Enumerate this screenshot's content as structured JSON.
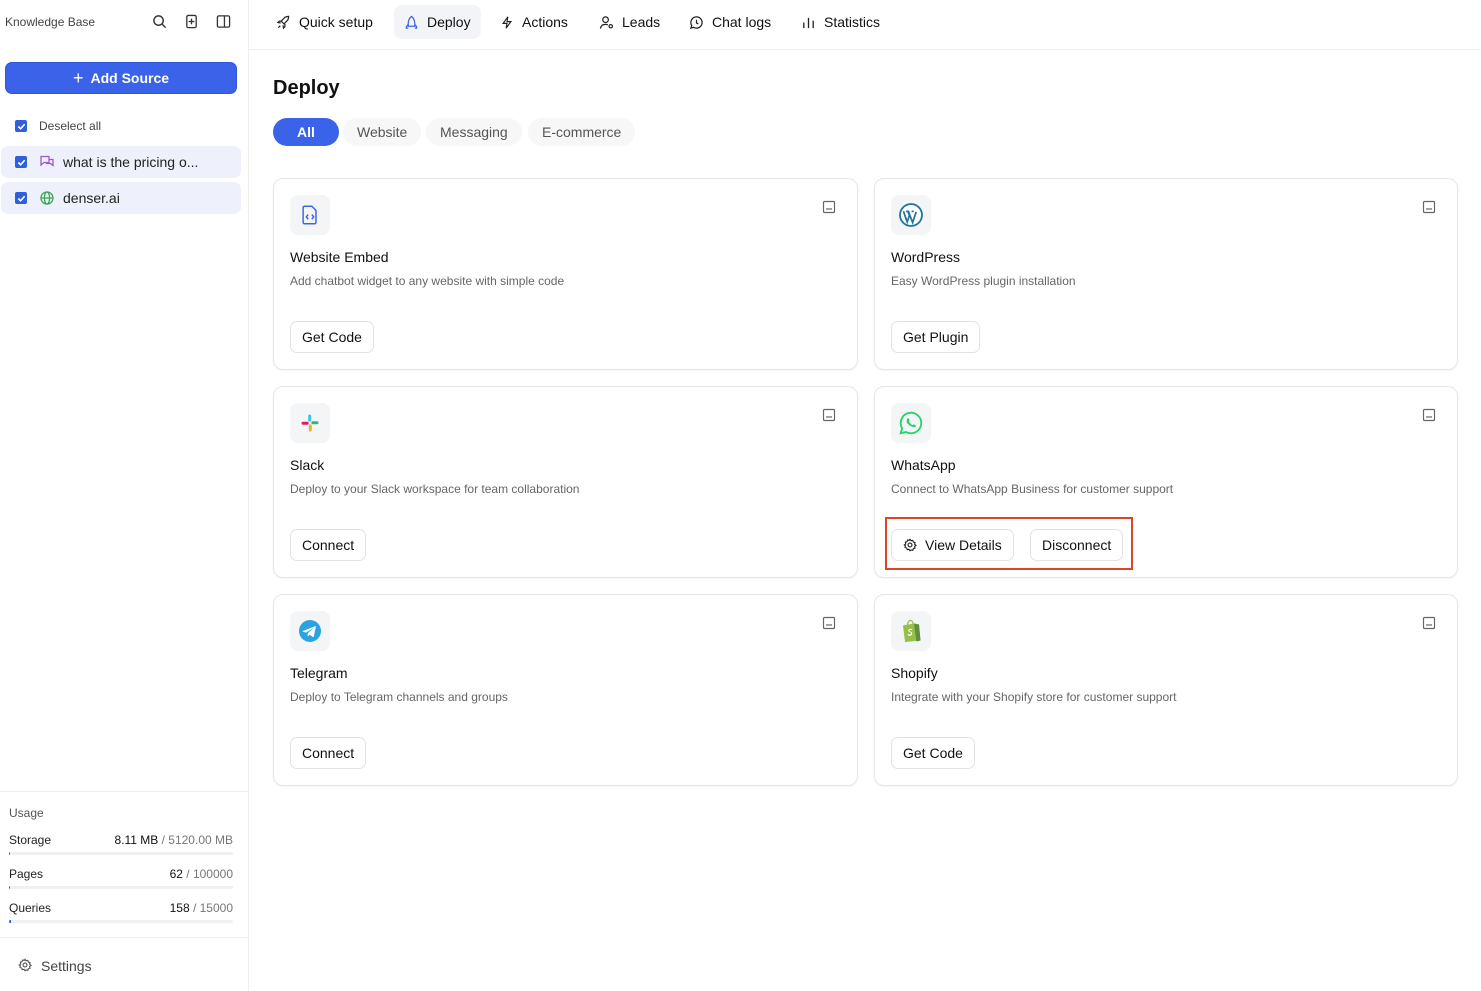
{
  "sidebar": {
    "title": "Knowledge Base",
    "add_source_label": "Add Source",
    "deselect_label": "Deselect all",
    "sources": [
      {
        "label": "what is the pricing o...",
        "icon": "chat-icon"
      },
      {
        "label": "denser.ai",
        "icon": "globe-icon"
      }
    ],
    "usage": {
      "title": "Usage",
      "rows": [
        {
          "label": "Storage",
          "used": "8.11 MB",
          "total": " / 5120.00 MB",
          "fraction": 0.0016
        },
        {
          "label": "Pages",
          "used": "62",
          "total": " / 100000",
          "fraction": 0.0006
        },
        {
          "label": "Queries",
          "used": "158",
          "total": " / 15000",
          "fraction": 0.0105
        }
      ]
    },
    "settings_label": "Settings"
  },
  "nav": {
    "items": [
      {
        "label": "Quick setup",
        "icon": "rocket-icon"
      },
      {
        "label": "Deploy",
        "icon": "deploy-icon",
        "active": true
      },
      {
        "label": "Actions",
        "icon": "bolt-icon"
      },
      {
        "label": "Leads",
        "icon": "user-icon"
      },
      {
        "label": "Chat logs",
        "icon": "chat-bubble-icon"
      },
      {
        "label": "Statistics",
        "icon": "bar-chart-icon"
      }
    ]
  },
  "main": {
    "title": "Deploy",
    "filters": [
      "All",
      "Website",
      "Messaging",
      "E-commerce"
    ],
    "active_filter": "All",
    "cards": [
      {
        "title": "Website Embed",
        "desc": "Add chatbot widget to any website with simple code",
        "buttons": [
          "Get Code"
        ],
        "icon": "code-file-icon"
      },
      {
        "title": "WordPress",
        "desc": "Easy WordPress plugin installation",
        "buttons": [
          "Get Plugin"
        ],
        "icon": "wordpress-icon"
      },
      {
        "title": "Slack",
        "desc": "Deploy to your Slack workspace for team collaboration",
        "buttons": [
          "Connect"
        ],
        "icon": "slack-icon"
      },
      {
        "title": "WhatsApp",
        "desc": "Connect to WhatsApp Business for customer support",
        "buttons": [
          "View Details",
          "Disconnect"
        ],
        "icon": "whatsapp-icon"
      },
      {
        "title": "Telegram",
        "desc": "Deploy to Telegram channels and groups",
        "buttons": [
          "Connect"
        ],
        "icon": "telegram-icon"
      },
      {
        "title": "Shopify",
        "desc": "Integrate with your Shopify store for customer support",
        "buttons": [
          "Get Code"
        ],
        "icon": "shopify-icon"
      }
    ]
  },
  "colors": {
    "accent": "#3b63ea",
    "highlight": "#d9472b",
    "whatsapp": "#25d366",
    "wordpress": "#21759b",
    "telegram": "#2aa3e0",
    "shopify": "#95bf47"
  }
}
